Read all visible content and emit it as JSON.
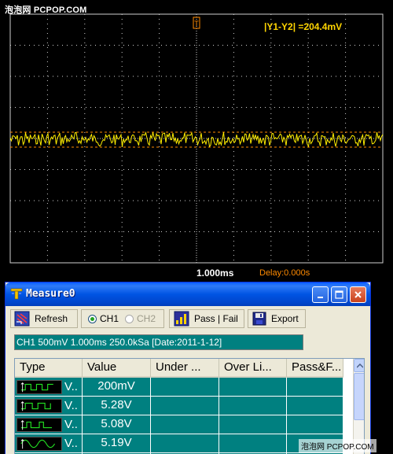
{
  "scope": {
    "watermark_top": "泡泡网 PCPOP.COM",
    "cursor_readout": "|Y1-Y2|  =204.4mV",
    "timebase": "1.000ms",
    "delay": "Delay:0.000s",
    "trigger_marker": "T",
    "colors": {
      "trace": "#ffee00",
      "grid": "#cfcfcf",
      "cursor": "#ff8a00"
    }
  },
  "window": {
    "title": "Measure0",
    "title_icon": "measure-app-icon",
    "controls": {
      "minimize": "minimize-icon",
      "maximize": "maximize-icon",
      "close": "close-icon"
    }
  },
  "toolbar": {
    "refresh_label": "Refresh",
    "ch1_label": "CH1",
    "ch2_label": "CH2",
    "selected_channel": "CH1",
    "passfail_label": "Pass | Fail",
    "export_label": "Export"
  },
  "info_bar": "CH1 500mV  1.000ms 250.0kSa  [Date:2011-1-12]",
  "table": {
    "columns": [
      "Type",
      "Value",
      "Under ...",
      "Over Li...",
      "Pass&F..."
    ],
    "rows": [
      {
        "type_abbr": "V..",
        "icon": "pulse-high-icon",
        "value": "200mV",
        "under": "",
        "over": "",
        "pass": ""
      },
      {
        "type_abbr": "V..",
        "icon": "pulse-top-icon",
        "value": "5.28V",
        "under": "",
        "over": "",
        "pass": ""
      },
      {
        "type_abbr": "V..",
        "icon": "pulse-base-icon",
        "value": "5.08V",
        "under": "",
        "over": "",
        "pass": ""
      },
      {
        "type_abbr": "V..",
        "icon": "sine-avg-icon",
        "value": "5.19V",
        "under": "",
        "over": "",
        "pass": ""
      },
      {
        "type_abbr": "",
        "icon": "pulse-icon",
        "value": "",
        "under": "",
        "over": "",
        "pass": ""
      }
    ]
  },
  "watermark_bottom": "泡泡网 PCPOP.COM"
}
